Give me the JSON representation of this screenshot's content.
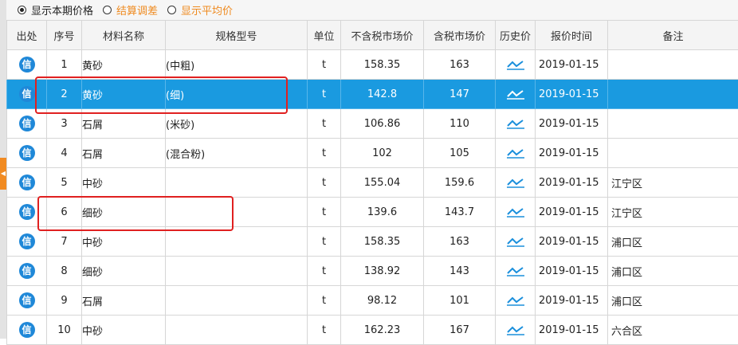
{
  "options": [
    {
      "label": "显示本期价格",
      "checked": true,
      "color": "#222222"
    },
    {
      "label": "结算调差",
      "checked": false,
      "color": "#ef8a1f"
    },
    {
      "label": "显示平均价",
      "checked": false,
      "color": "#ef8a1f"
    }
  ],
  "columns": [
    "出处",
    "序号",
    "材料名称",
    "规格型号",
    "单位",
    "不含税市场价",
    "含税市场价",
    "历史价",
    "报价时间",
    "备注"
  ],
  "source_icon_text": "信",
  "colors": {
    "selected_row": "#1a9ae0",
    "source_icon": "#1f88d8",
    "annotation_box": "#e02020"
  },
  "rows": [
    {
      "seq": "1",
      "name": "黄砂",
      "spec": "(中粗)",
      "unit": "t",
      "price_ex_tax": "158.35",
      "price_inc_tax": "163",
      "quote_date": "2019-01-15",
      "note": ""
    },
    {
      "seq": "2",
      "name": "黄砂",
      "spec": "(细)",
      "unit": "t",
      "price_ex_tax": "142.8",
      "price_inc_tax": "147",
      "quote_date": "2019-01-15",
      "note": "",
      "selected": true
    },
    {
      "seq": "3",
      "name": "石屑",
      "spec": "(米砂)",
      "unit": "t",
      "price_ex_tax": "106.86",
      "price_inc_tax": "110",
      "quote_date": "2019-01-15",
      "note": ""
    },
    {
      "seq": "4",
      "name": "石屑",
      "spec": "(混合粉)",
      "unit": "t",
      "price_ex_tax": "102",
      "price_inc_tax": "105",
      "quote_date": "2019-01-15",
      "note": ""
    },
    {
      "seq": "5",
      "name": "中砂",
      "spec": "",
      "unit": "t",
      "price_ex_tax": "155.04",
      "price_inc_tax": "159.6",
      "quote_date": "2019-01-15",
      "note": "江宁区"
    },
    {
      "seq": "6",
      "name": "细砂",
      "spec": "",
      "unit": "t",
      "price_ex_tax": "139.6",
      "price_inc_tax": "143.7",
      "quote_date": "2019-01-15",
      "note": "江宁区"
    },
    {
      "seq": "7",
      "name": "中砂",
      "spec": "",
      "unit": "t",
      "price_ex_tax": "158.35",
      "price_inc_tax": "163",
      "quote_date": "2019-01-15",
      "note": "浦口区"
    },
    {
      "seq": "8",
      "name": "细砂",
      "spec": "",
      "unit": "t",
      "price_ex_tax": "138.92",
      "price_inc_tax": "143",
      "quote_date": "2019-01-15",
      "note": "浦口区"
    },
    {
      "seq": "9",
      "name": "石屑",
      "spec": "",
      "unit": "t",
      "price_ex_tax": "98.12",
      "price_inc_tax": "101",
      "quote_date": "2019-01-15",
      "note": "浦口区"
    },
    {
      "seq": "10",
      "name": "中砂",
      "spec": "",
      "unit": "t",
      "price_ex_tax": "162.23",
      "price_inc_tax": "167",
      "quote_date": "2019-01-15",
      "note": "六合区"
    }
  ]
}
